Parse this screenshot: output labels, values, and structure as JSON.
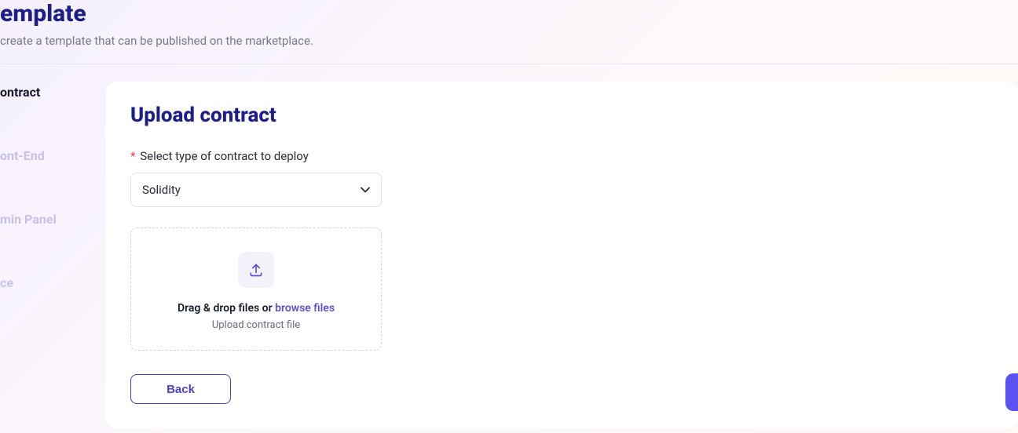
{
  "header": {
    "title": "emplate",
    "subtitle": "create a template that can be published on the marketplace."
  },
  "sidebar": {
    "steps": [
      {
        "label": "ontract",
        "active": true
      },
      {
        "label": "",
        "active": false
      },
      {
        "label": "",
        "active": false
      },
      {
        "label": "ont-End",
        "active": false
      },
      {
        "label": "min Panel",
        "active": false
      },
      {
        "label": "",
        "active": false
      },
      {
        "label": "ce",
        "active": false
      }
    ]
  },
  "main": {
    "title": "Upload contract",
    "field_label": "Select type of contract to deploy",
    "select_value": "Solidity",
    "dropzone": {
      "line1_prefix": "Drag & drop files or ",
      "line1_link": "browse files",
      "line2": "Upload contract file"
    },
    "back_label": "Back"
  }
}
